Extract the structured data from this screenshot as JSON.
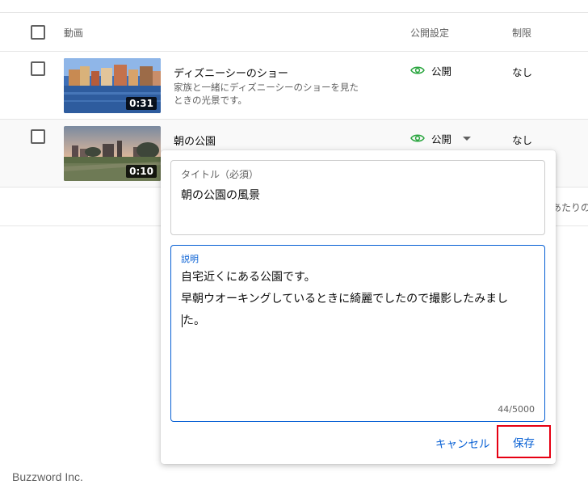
{
  "header": {
    "video_col": "動画",
    "visibility_col": "公開設定",
    "restriction_col": "制限"
  },
  "videos": [
    {
      "title": "ディズニーシーのショー",
      "description_line1": "家族と一緒にディズニーシーのショーを見た",
      "description_line2": "ときの光景です。",
      "duration": "0:31",
      "visibility": "公開",
      "restriction": "なし"
    },
    {
      "title": "朝の公園",
      "duration": "0:10",
      "visibility": "公開",
      "restriction": "なし"
    }
  ],
  "partial_text": "あたりの",
  "editor": {
    "title_label": "タイトル（必須）",
    "title_value": "朝の公園の風景",
    "description_label": "説明",
    "description_line1": "自宅近くにある公園です。",
    "description_line2": "早朝ウオーキングしているときに綺麗でしたので撮影したみまし",
    "description_line3": "た。",
    "counter": "44/5000",
    "cancel_label": "キャンセル",
    "save_label": "保存"
  },
  "footer": {
    "company": "Buzzword Inc."
  },
  "colors": {
    "accent": "#065fd4",
    "visibility_icon": "#2ba640",
    "highlight_border": "#e60012"
  }
}
